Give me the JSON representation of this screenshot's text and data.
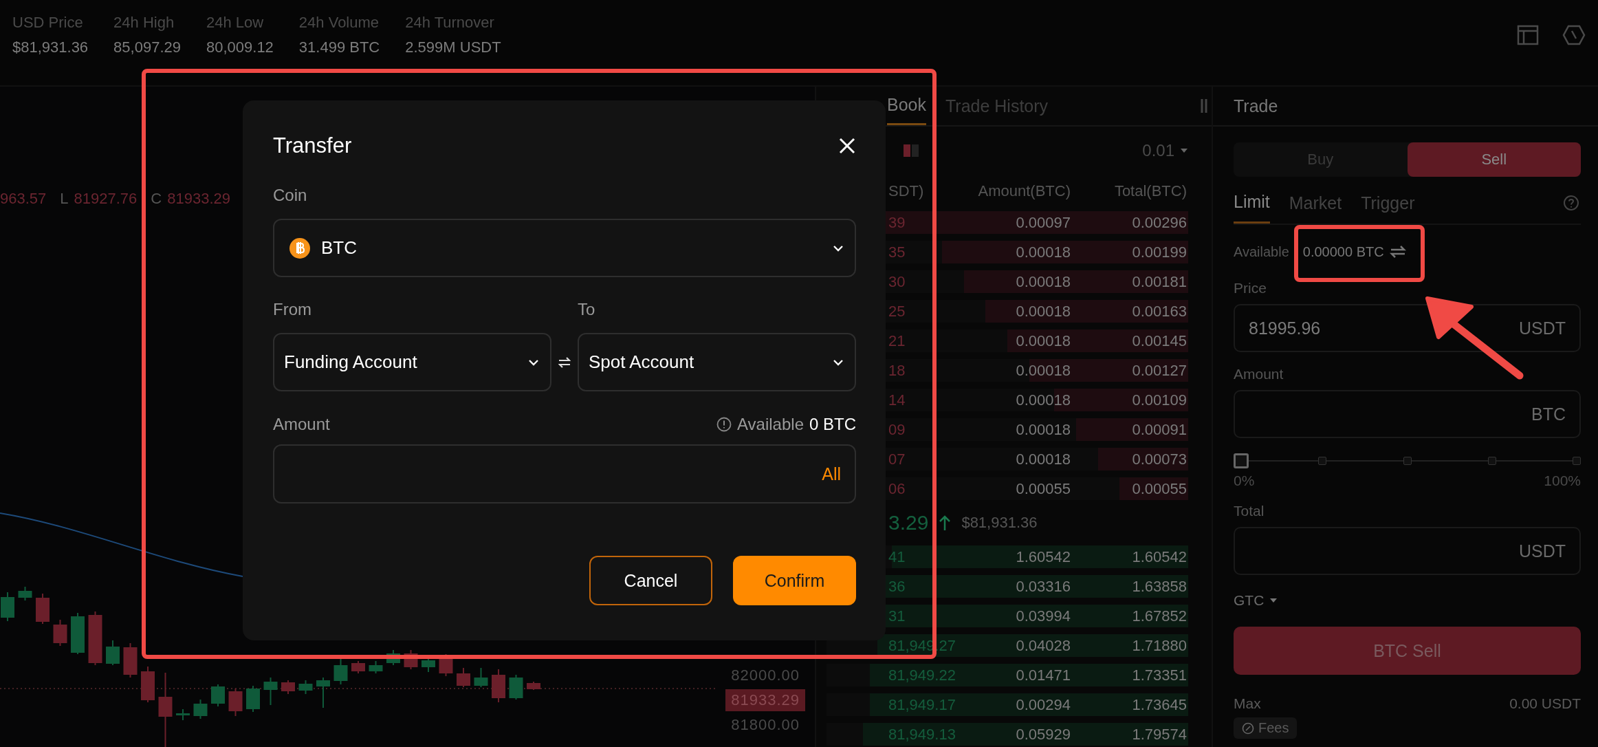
{
  "header": {
    "stats": [
      {
        "label": "USD Price",
        "value": "$81,931.36"
      },
      {
        "label": "24h High",
        "value": "85,097.29"
      },
      {
        "label": "24h Low",
        "value": "80,009.12"
      },
      {
        "label": "24h Volume",
        "value": "31.499 BTC"
      },
      {
        "label": "24h Turnover",
        "value": "2.599M USDT"
      }
    ]
  },
  "chart": {
    "ohlc": [
      {
        "value": "963.57"
      },
      {
        "key": "L",
        "value": "81927.76"
      },
      {
        "key": "C",
        "value": "81933.29"
      }
    ],
    "axis_labels": [
      {
        "text": "82000.00",
        "current": false
      },
      {
        "text": "81933.29",
        "current": true
      },
      {
        "text": "81800.00",
        "current": false
      }
    ]
  },
  "order_book": {
    "tabs": [
      {
        "label": "Book",
        "selected": true
      },
      {
        "label": "Trade History",
        "selected": false
      }
    ],
    "precision": "0.01",
    "columns": [
      "SDT)",
      "Amount(BTC)",
      "Total(BTC)"
    ],
    "asks": [
      {
        "price": "39",
        "amount": "0.00097",
        "total": "0.00296",
        "level": 0.98
      },
      {
        "price": "35",
        "amount": "0.00018",
        "total": "0.00199",
        "level": 0.68
      },
      {
        "price": "30",
        "amount": "0.00018",
        "total": "0.00181",
        "level": 0.62
      },
      {
        "price": "25",
        "amount": "0.00018",
        "total": "0.00163",
        "level": 0.56
      },
      {
        "price": "21",
        "amount": "0.00018",
        "total": "0.00145",
        "level": 0.5
      },
      {
        "price": "18",
        "amount": "0.00018",
        "total": "0.00127",
        "level": 0.44
      },
      {
        "price": "14",
        "amount": "0.00018",
        "total": "0.00109",
        "level": 0.37
      },
      {
        "price": "09",
        "amount": "0.00018",
        "total": "0.00091",
        "level": 0.31
      },
      {
        "price": "07",
        "amount": "0.00018",
        "total": "0.00073",
        "level": 0.25
      },
      {
        "price": "06",
        "amount": "0.00055",
        "total": "0.00055",
        "level": 0.19
      }
    ],
    "last_price": "3.29",
    "last_price_usd": "$81,931.36",
    "bids": [
      {
        "price": "41",
        "amount": "1.60542",
        "total": "1.60542",
        "level": 0.82
      },
      {
        "price": "36",
        "amount": "0.03316",
        "total": "1.63858",
        "level": 0.84
      },
      {
        "price": "31",
        "amount": "0.03994",
        "total": "1.67852",
        "level": 0.86
      },
      {
        "price": "81,949.27",
        "amount": "0.04028",
        "total": "1.71880",
        "level": 0.86
      },
      {
        "price": "81,949.22",
        "amount": "0.01471",
        "total": "1.73351",
        "level": 0.88
      },
      {
        "price": "81,949.17",
        "amount": "0.00294",
        "total": "1.73645",
        "level": 0.88
      },
      {
        "price": "81,949.13",
        "amount": "0.05929",
        "total": "1.79574",
        "level": 0.9
      }
    ]
  },
  "trade": {
    "title": "Trade",
    "sides": [
      {
        "label": "Buy",
        "selected": false
      },
      {
        "label": "Sell",
        "selected": true
      }
    ],
    "order_types": [
      {
        "label": "Limit",
        "selected": true
      },
      {
        "label": "Market",
        "selected": false
      },
      {
        "label": "Trigger",
        "selected": false
      }
    ],
    "available_label": "Available",
    "available_value": "0.00000 BTC",
    "price": {
      "label": "Price",
      "value": "81995.96",
      "unit": "USDT"
    },
    "amount": {
      "label": "Amount",
      "unit": "BTC"
    },
    "slider": {
      "level": 0,
      "min_label": "0%",
      "max_label": "100%"
    },
    "total": {
      "label": "Total",
      "unit": "USDT"
    },
    "time_in_force": "GTC",
    "submit": "BTC Sell",
    "max_label": "Max",
    "max_value": "0.00 USDT",
    "fees": "Fees"
  },
  "modal": {
    "title": "Transfer",
    "coin_label": "Coin",
    "coin": "BTC",
    "from_label": "From",
    "from": "Funding Account",
    "to_label": "To",
    "to": "Spot Account",
    "amount_label": "Amount",
    "available_label": "Available",
    "available_value": "0 BTC",
    "all": "All",
    "buttons": [
      {
        "label": "Cancel",
        "kind": "secondary"
      },
      {
        "label": "Confirm",
        "kind": "primary"
      }
    ]
  }
}
